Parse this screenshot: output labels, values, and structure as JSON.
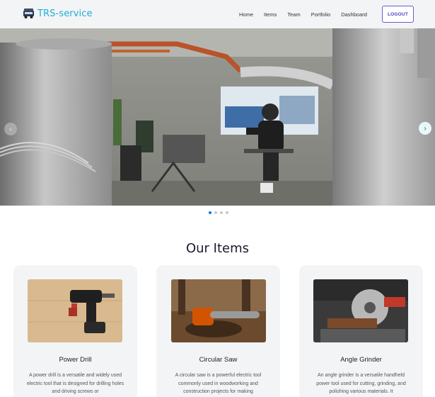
{
  "navbar": {
    "brand": "TRS-service",
    "links": [
      "Home",
      "Items",
      "Team",
      "Portfolio",
      "Dashboard"
    ],
    "logout_label": "LOGOUT"
  },
  "hero": {
    "left_arrow": "‹",
    "right_arrow": "›",
    "slide_count": 4,
    "active_slide": 1
  },
  "items_section": {
    "title": "Our Items",
    "cards": [
      {
        "title": "Power Drill",
        "description": "A power drill is a versatile and widely used electric tool that is designed for drilling holes and driving screws or"
      },
      {
        "title": "Circular Saw",
        "description": "A circular saw is a powerful electric tool commonly used in woodworking and construction projects for making"
      },
      {
        "title": "Angle Grinder",
        "description": "An angle grinder is a versatile handheld power tool used for cutting, grinding, and polishing various materials. It"
      }
    ]
  },
  "colors": {
    "brand": "#1ab0d8",
    "navbar_bg": "#f3f4f6",
    "logout_border": "#6b5bd6",
    "dot_active": "#1a73e8"
  }
}
